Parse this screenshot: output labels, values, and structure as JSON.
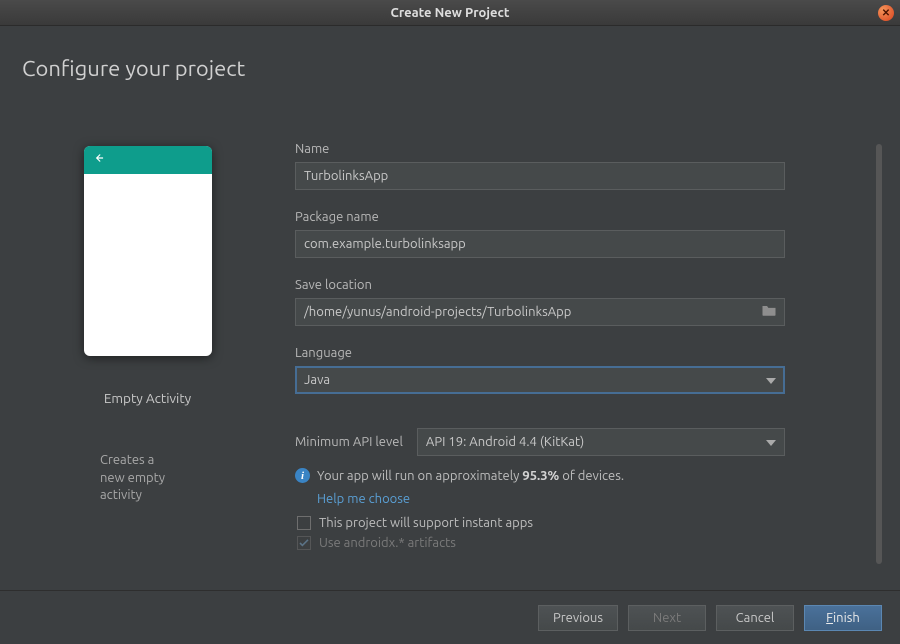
{
  "titlebar": {
    "title": "Create New Project"
  },
  "page": {
    "heading": "Configure your project"
  },
  "preview": {
    "template_name": "Empty Activity",
    "template_desc": "Creates a new empty activity"
  },
  "form": {
    "name_label": "Name",
    "name_value": "TurbolinksApp",
    "package_label": "Package name",
    "package_value": "com.example.turbolinksapp",
    "save_label": "Save location",
    "save_value": "/home/yunus/android-projects/TurbolinksApp",
    "language_label": "Language",
    "language_value": "Java",
    "api_label": "Minimum API level",
    "api_value": "API 19: Android 4.4 (KitKat)",
    "compat_pre": "Your app will run on approximately ",
    "compat_pct": "95.3%",
    "compat_post": " of devices.",
    "help_link": "Help me choose",
    "instant_label": "This project will support instant apps",
    "androidx_label": "Use androidx.* artifacts"
  },
  "footer": {
    "previous": "Previous",
    "next": "Next",
    "cancel": "Cancel",
    "finish_u": "F",
    "finish_rest": "inish"
  }
}
